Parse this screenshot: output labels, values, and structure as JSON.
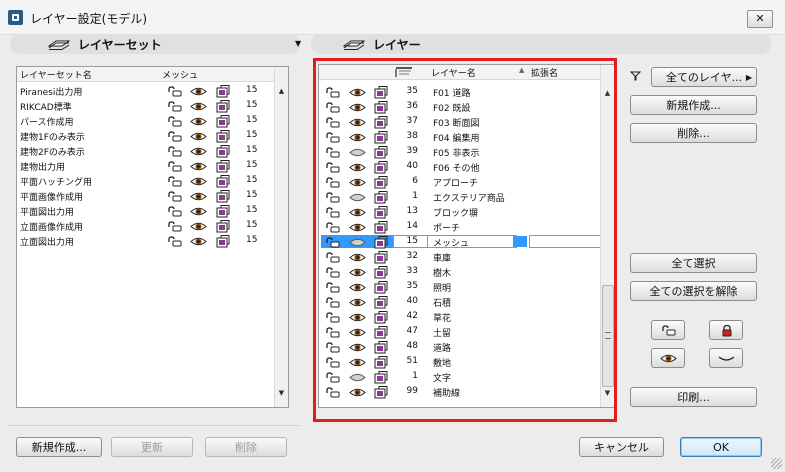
{
  "window": {
    "title": "レイヤー設定(モデル)",
    "close_glyph": "✕"
  },
  "left_panel": {
    "title": "レイヤーセット",
    "columns": [
      "レイヤーセット名",
      "メッシュ"
    ],
    "rows": [
      {
        "name": "Piranesi出力用",
        "count": "15"
      },
      {
        "name": "RIKCAD標準",
        "count": "15"
      },
      {
        "name": "パース作成用",
        "count": "15"
      },
      {
        "name": "建物1Fのみ表示",
        "count": "15"
      },
      {
        "name": "建物2Fのみ表示",
        "count": "15"
      },
      {
        "name": "建物出力用",
        "count": "15"
      },
      {
        "name": "平面ハッチング用",
        "count": "15"
      },
      {
        "name": "平面画像作成用",
        "count": "15"
      },
      {
        "name": "平面図出力用",
        "count": "15"
      },
      {
        "name": "立面画像作成用",
        "count": "15"
      },
      {
        "name": "立面図出力用",
        "count": "15"
      }
    ],
    "buttons": {
      "new": "新規作成...",
      "update": "更新",
      "delete": "削除"
    }
  },
  "right_panel": {
    "title": "レイヤー",
    "columns": {
      "name": "レイヤー名",
      "ext": "拡張名"
    },
    "rows": [
      {
        "num": "35",
        "name": "F01 道路",
        "eye": "open"
      },
      {
        "num": "36",
        "name": "F02 既設",
        "eye": "open"
      },
      {
        "num": "37",
        "name": "F03 断面図",
        "eye": "open"
      },
      {
        "num": "38",
        "name": "F04 編集用",
        "eye": "open"
      },
      {
        "num": "39",
        "name": "F05 非表示",
        "eye": "hidden"
      },
      {
        "num": "40",
        "name": "F06 その他",
        "eye": "open"
      },
      {
        "num": "6",
        "name": "アプローチ",
        "eye": "open"
      },
      {
        "num": "1",
        "name": "エクステリア商品",
        "eye": "hidden"
      },
      {
        "num": "13",
        "name": "ブロック塀",
        "eye": "open"
      },
      {
        "num": "14",
        "name": "ポーチ",
        "eye": "open"
      },
      {
        "num": "15",
        "name": "メッシュ",
        "eye": "hidden"
      },
      {
        "num": "32",
        "name": "車庫",
        "eye": "open"
      },
      {
        "num": "33",
        "name": "樹木",
        "eye": "open"
      },
      {
        "num": "35",
        "name": "照明",
        "eye": "open"
      },
      {
        "num": "40",
        "name": "石積",
        "eye": "open"
      },
      {
        "num": "42",
        "name": "草花",
        "eye": "open"
      },
      {
        "num": "47",
        "name": "土留",
        "eye": "open"
      },
      {
        "num": "48",
        "name": "道路",
        "eye": "open"
      },
      {
        "num": "51",
        "name": "敷地",
        "eye": "open"
      },
      {
        "num": "1",
        "name": "文字",
        "eye": "hidden"
      },
      {
        "num": "99",
        "name": "補助線",
        "eye": "open"
      }
    ],
    "selected_index": 10
  },
  "actions": {
    "filter": "全てのレイヤ...",
    "new": "新規作成...",
    "delete": "削除...",
    "select_all": "全て選択",
    "deselect_all": "全ての選択を解除",
    "print": "印刷..."
  },
  "footer": {
    "cancel": "キャンセル",
    "ok": "OK"
  },
  "colors": {
    "highlight": "#e02020",
    "selection": "#3399ff",
    "layer_icon": "#8a3a92"
  }
}
